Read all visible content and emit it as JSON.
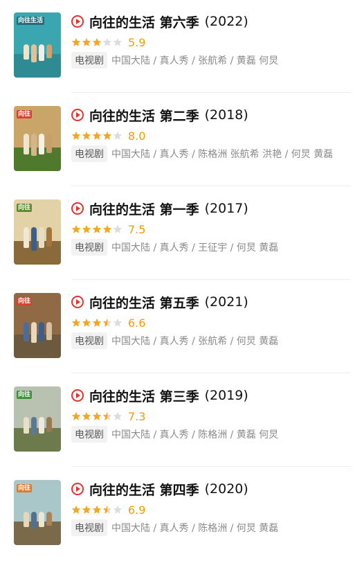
{
  "accent": {
    "play": "#e8312b",
    "star_on": "#f5a623",
    "star_off": "#dcdcdc",
    "score": "#f59a0c"
  },
  "items": [
    {
      "title": "向往的生活 第六季",
      "year": "(2022)",
      "stars": 3,
      "score": "5.9",
      "type": "电视剧",
      "meta": "中国大陆 / 真人秀 / 张航希 / 黄磊 何炅",
      "poster": {
        "sky": "#3aa6b0",
        "ground": "#2e8a93",
        "logo": "向往生活",
        "logo_bg": "#1f6f78",
        "logo_fg": "#ffffff"
      }
    },
    {
      "title": "向往的生活 第二季",
      "year": "(2018)",
      "stars": 4,
      "score": "8.0",
      "type": "电视剧",
      "meta": "中国大陆 / 真人秀 / 陈格洲 张航希 洪艳 / 何炅 黄磊",
      "poster": {
        "sky": "#c9a56a",
        "ground": "#4f7a2d",
        "logo": "向往",
        "logo_bg": "#d8402f",
        "logo_fg": "#ffffff"
      }
    },
    {
      "title": "向往的生活 第一季",
      "year": "(2017)",
      "stars": 4,
      "score": "7.5",
      "type": "电视剧",
      "meta": "中国大陆 / 真人秀 / 王征宇 / 何炅 黄磊",
      "poster": {
        "sky": "#e3d2a8",
        "ground": "#8a6a3a",
        "logo": "向往",
        "logo_bg": "#5b8b2e",
        "logo_fg": "#ffffff"
      }
    },
    {
      "title": "向往的生活 第五季",
      "year": "(2021)",
      "stars": 3.5,
      "score": "6.6",
      "type": "电视剧",
      "meta": "中国大陆 / 真人秀 / 张航希 / 何炅 黄磊",
      "poster": {
        "sky": "#8f6a45",
        "ground": "#6d5a3e",
        "logo": "向往",
        "logo_bg": "#d8402f",
        "logo_fg": "#ffffff"
      }
    },
    {
      "title": "向往的生活 第三季",
      "year": "(2019)",
      "stars": 3.5,
      "score": "7.3",
      "type": "电视剧",
      "meta": "中国大陆 / 真人秀 / 陈格洲 / 黄磊 何炅",
      "poster": {
        "sky": "#b9c2b0",
        "ground": "#6c7a4c",
        "logo": "向往",
        "logo_bg": "#3f8d3a",
        "logo_fg": "#ffffff"
      }
    },
    {
      "title": "向往的生活 第四季",
      "year": "(2020)",
      "stars": 3.5,
      "score": "6.9",
      "type": "电视剧",
      "meta": "中国大陆 / 真人秀 / 陈格洲 / 何炅 黄磊",
      "poster": {
        "sky": "#a9c7c9",
        "ground": "#7a6a4a",
        "logo": "向往",
        "logo_bg": "#e0782c",
        "logo_fg": "#ffffff"
      }
    }
  ]
}
